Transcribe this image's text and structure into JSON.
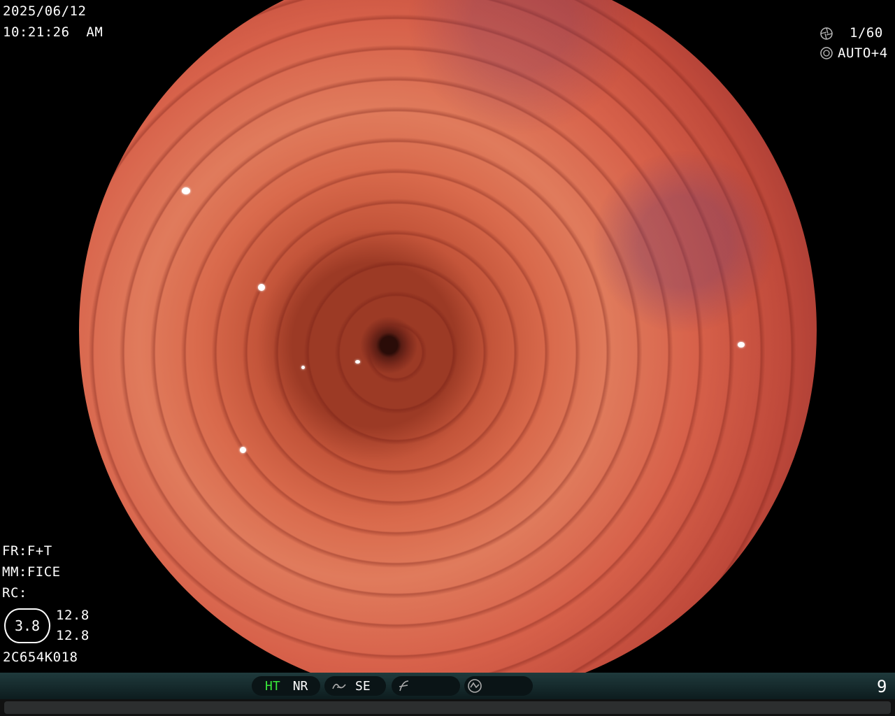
{
  "overlay": {
    "date": "2025/06/12",
    "time": "10:21:26  AM",
    "shutter": "1/60",
    "iris": "AUTO+4",
    "fr": "FR:F+T",
    "mm": "MM:FICE",
    "rc": "RC:",
    "badge_value": "3.8",
    "scale_top": "12.8",
    "scale_bottom": "12.8",
    "serial": "2C654K018"
  },
  "statusbar": {
    "ht": "HT",
    "nr": "NR",
    "se": "SE",
    "page_number": "9",
    "colors": {
      "ht_active": "#39e83a",
      "bar": "#1f3a3c"
    }
  },
  "icons": [
    "aperture-icon",
    "iris-icon",
    "structure-enhance-icon",
    "color-tone-icon",
    "freeze-icon"
  ]
}
